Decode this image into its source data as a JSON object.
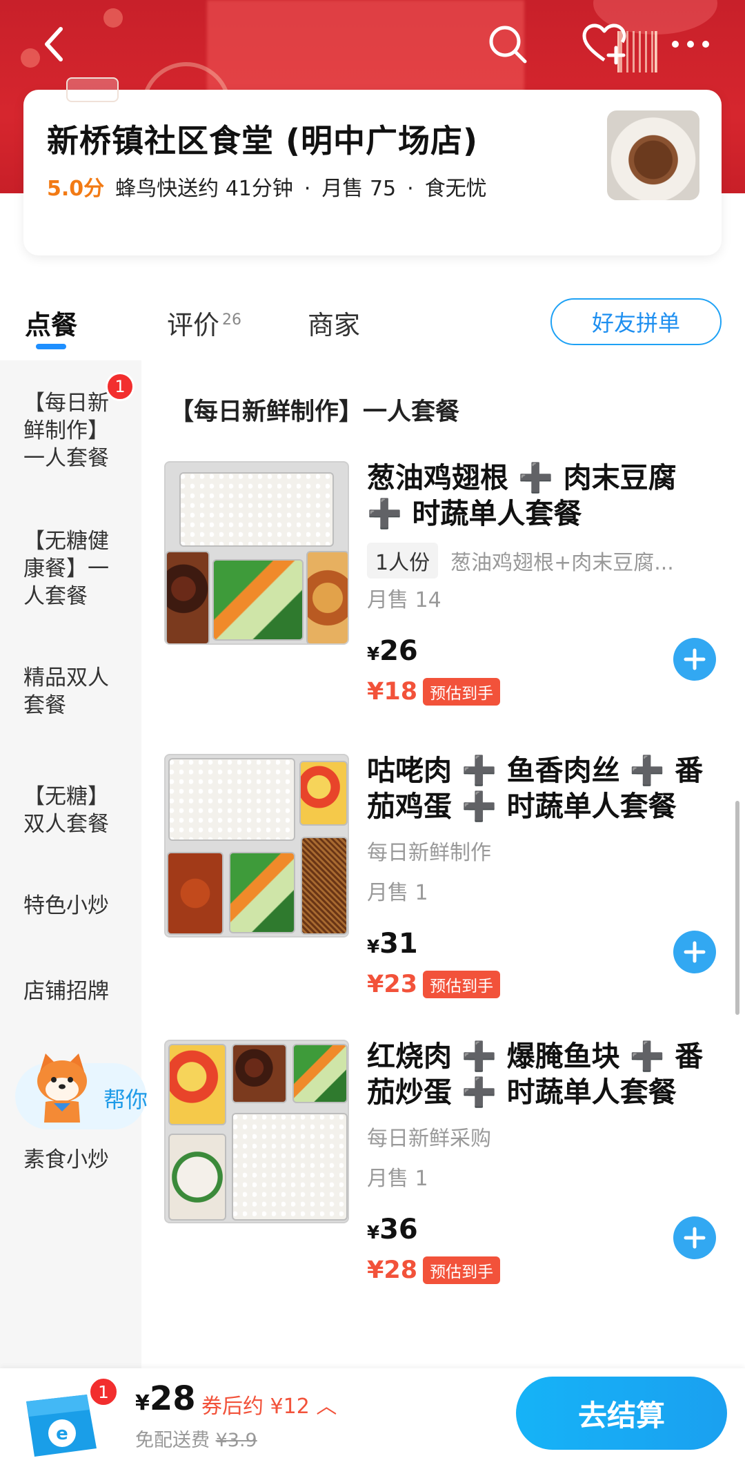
{
  "shop": {
    "name": "新桥镇社区食堂 (明中广场店)",
    "score": "5.0分",
    "delivery": "蜂鸟快送约 41分钟",
    "dot1": "·",
    "sales": "月售 75",
    "dot2": "·",
    "tag": "食无忧"
  },
  "tabs": {
    "order": "点餐",
    "review": "评价",
    "review_count": "26",
    "merchant": "商家",
    "friend_order": "好友拼单"
  },
  "sidebar": {
    "badge": "1",
    "items": [
      "【每日新\n鲜制作】\n一人套餐",
      "【无糖健\n康餐】一\n人套餐",
      "精品双人\n套餐",
      "【无糖】\n双人套餐",
      "特色小炒",
      "店铺招牌",
      "素食小炒"
    ],
    "helper_text": "帮你"
  },
  "section_title": "【每日新鲜制作】一人套餐",
  "dishes": [
    {
      "name": "葱油鸡翅根 ➕ 肉末豆腐 ➕ 时蔬单人套餐",
      "tag": "1人份",
      "desc": "葱油鸡翅根+肉末豆腐...",
      "sales": "月售 14",
      "price_symbol": "¥",
      "price": "26",
      "est_price": "¥18",
      "est_label": "预估到手"
    },
    {
      "name": "咕咾肉 ➕ 鱼香肉丝 ➕ 番茄鸡蛋 ➕ 时蔬单人套餐",
      "desc": "每日新鲜制作",
      "sales": "月售 1",
      "price_symbol": "¥",
      "price": "31",
      "est_price": "¥23",
      "est_label": "预估到手"
    },
    {
      "name": "红烧肉 ➕ 爆腌鱼块 ➕ 番茄炒蛋 ➕ 时蔬单人套餐",
      "desc": "每日新鲜采购",
      "sales": "月售 1",
      "price_symbol": "¥",
      "price": "36",
      "est_price": "¥28",
      "est_label": "预估到手"
    }
  ],
  "cart": {
    "badge": "1",
    "price_symbol": "¥",
    "total": "28",
    "coupon": "券后约 ¥12 ︿",
    "delivery_label": "免配送费",
    "delivery_old": "¥3.9",
    "checkout": "去结算"
  },
  "colors": {
    "banner": "#d6262e",
    "accent_blue": "#1ea1f5",
    "price_red": "#f2523a",
    "score_orange": "#f27a14"
  }
}
